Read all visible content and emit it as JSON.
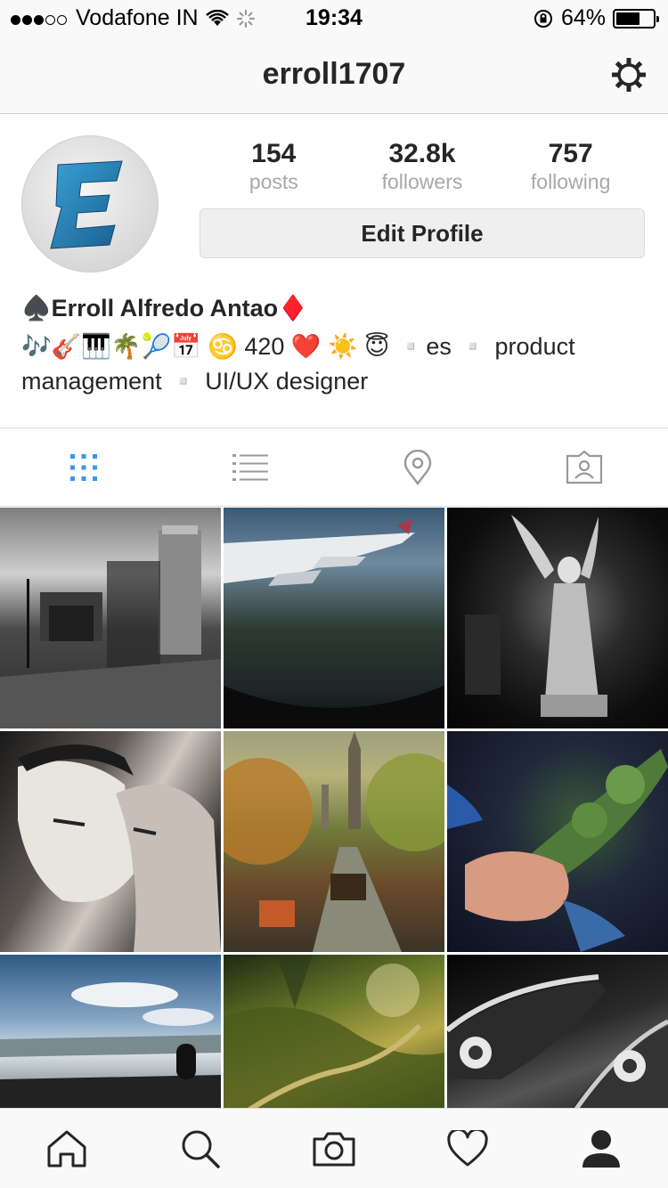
{
  "status_bar": {
    "carrier": "Vodafone IN",
    "time": "19:34",
    "battery": "64%",
    "battery_level": 0.64
  },
  "nav": {
    "title": "erroll1707",
    "settings_icon": "gear-icon"
  },
  "profile": {
    "avatar_letter": "E",
    "stats": [
      {
        "value": "154",
        "label": "posts"
      },
      {
        "value": "32.8k",
        "label": "followers"
      },
      {
        "value": "757",
        "label": "following"
      }
    ],
    "edit_label": "Edit Profile",
    "name": "♠️Erroll Alfredo Antao♦️",
    "bio": "🎶🎸🎹🌴🎾📅 ♋️ 420 ❤️ ☀️ 😇 ▫️es ▫️ product management ▫️ UI/UX designer"
  },
  "view_tabs": [
    {
      "name": "grid-view",
      "icon": "grid-icon",
      "active": true
    },
    {
      "name": "list-view",
      "icon": "list-icon",
      "active": false
    },
    {
      "name": "map-view",
      "icon": "location-pin-icon",
      "active": false
    },
    {
      "name": "tagged-view",
      "icon": "tagged-user-icon",
      "active": false
    }
  ],
  "posts": [
    {
      "description": "black and white street with arch"
    },
    {
      "description": "airplane window aerial view"
    },
    {
      "description": "angel statue"
    },
    {
      "description": "black and white couple"
    },
    {
      "description": "painting of street with cathedral"
    },
    {
      "description": "hands holding plant"
    },
    {
      "description": "sky through car window"
    },
    {
      "description": "green hills path"
    },
    {
      "description": "black converse sneaker"
    }
  ],
  "tab_bar": [
    {
      "name": "home",
      "icon": "home-icon"
    },
    {
      "name": "search",
      "icon": "search-icon"
    },
    {
      "name": "camera",
      "icon": "camera-icon"
    },
    {
      "name": "activity",
      "icon": "heart-icon"
    },
    {
      "name": "profile",
      "icon": "profile-icon"
    }
  ]
}
